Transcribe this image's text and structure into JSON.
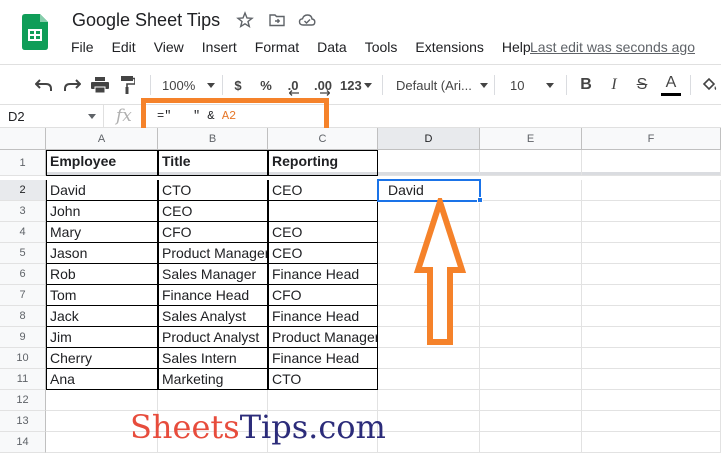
{
  "doc": {
    "title": "Google Sheet Tips",
    "last_edit": "Last edit was seconds ago",
    "menu": [
      "File",
      "Edit",
      "View",
      "Insert",
      "Format",
      "Data",
      "Tools",
      "Extensions",
      "Help"
    ]
  },
  "toolbar": {
    "zoom": "100%",
    "currency": "$",
    "percent": "%",
    "decrease_decimal": ".0",
    "increase_decimal": ".00",
    "more_formats": "123",
    "font": "Default (Ari...",
    "font_size": "10",
    "bold": "B",
    "italic": "I",
    "strike": "S",
    "text_color": "A"
  },
  "formula_bar": {
    "name_box": "D2",
    "fx": "fx",
    "formula_prefix": "=\"   \" & ",
    "formula_ref": "A2"
  },
  "columns": [
    "A",
    "B",
    "C",
    "D",
    "E",
    "F"
  ],
  "rows": [
    "1",
    "2",
    "3",
    "4",
    "5",
    "6",
    "7",
    "8",
    "9",
    "10",
    "11",
    "12",
    "13",
    "14"
  ],
  "table": {
    "headers": [
      "Employee",
      "Title",
      "Reporting"
    ],
    "data": [
      [
        "David",
        "CTO",
        "CEO"
      ],
      [
        "John",
        "CEO",
        ""
      ],
      [
        "Mary",
        "CFO",
        "CEO"
      ],
      [
        "Jason",
        "Product Manager",
        "CEO"
      ],
      [
        "Rob",
        "Sales Manager",
        "Finance Head"
      ],
      [
        "Tom",
        "Finance Head",
        "CFO"
      ],
      [
        "Jack",
        "Sales Analyst",
        "Finance Head"
      ],
      [
        "Jim",
        "Product Analyst",
        "Product Manager"
      ],
      [
        "Cherry",
        "Sales Intern",
        "Finance Head"
      ],
      [
        "Ana",
        "Marketing",
        "CTO"
      ]
    ]
  },
  "selected_cell": {
    "ref": "D2",
    "value": "David"
  },
  "watermark": {
    "part1": "Sheets",
    "part2": "Tips.com"
  },
  "colors": {
    "accent": "#1a73e8",
    "annotation": "#f5822a",
    "sheets_green": "#0f9d58"
  }
}
